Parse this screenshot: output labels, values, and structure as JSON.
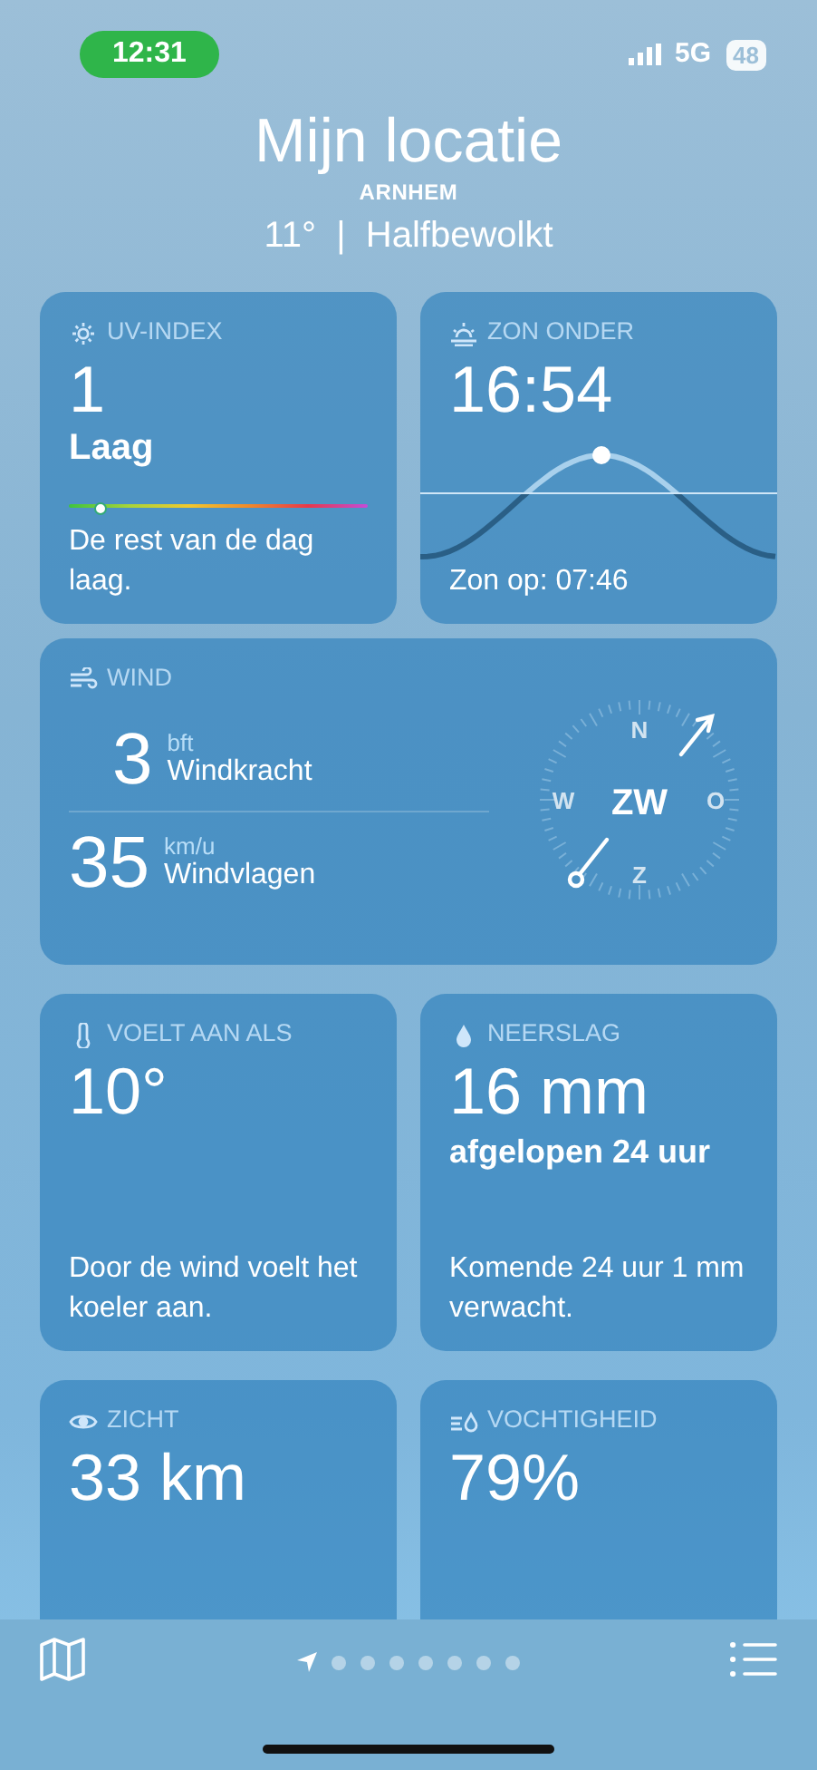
{
  "status_bar": {
    "time": "12:31",
    "network": "5G",
    "battery": "48"
  },
  "header": {
    "location": "Mijn locatie",
    "city": "ARNHEM",
    "summary": "11°  |  Halfbewolkt"
  },
  "uv": {
    "title": "UV-INDEX",
    "value": "1",
    "label": "Laag",
    "level": 0.1,
    "description": "De rest van de dag laag."
  },
  "sunset": {
    "title": "ZON ONDER",
    "value": "16:54",
    "footer": "Zon op: 07:46"
  },
  "wind": {
    "title": "WIND",
    "rows": [
      {
        "value": "3",
        "unit": "bft",
        "label": "Windkracht"
      },
      {
        "value": "35",
        "unit": "km/u",
        "label": "Windvlagen"
      }
    ],
    "compass": {
      "direction": "ZW",
      "north": "N",
      "east": "O",
      "south": "Z",
      "west": "W"
    }
  },
  "feels_like": {
    "title": "VOELT AAN ALS",
    "value": "10°",
    "description": "Door de wind voelt het koeler aan."
  },
  "precipitation": {
    "title": "NEERSLAG",
    "value": "16 mm",
    "subtitle": "afgelopen 24 uur",
    "description": "Komende 24 uur 1 mm verwacht."
  },
  "visibility": {
    "title": "ZICHT",
    "value": "33 km"
  },
  "humidity": {
    "title": "VOCHTIGHEID",
    "value": "79%"
  },
  "pages": [
    {
      "kind": "location",
      "selected": true
    },
    {
      "kind": "dot",
      "selected": false
    },
    {
      "kind": "dot",
      "selected": false
    },
    {
      "kind": "dot",
      "selected": false
    },
    {
      "kind": "dot",
      "selected": false
    },
    {
      "kind": "dot",
      "selected": false
    },
    {
      "kind": "dot",
      "selected": false
    },
    {
      "kind": "dot",
      "selected": false
    }
  ]
}
